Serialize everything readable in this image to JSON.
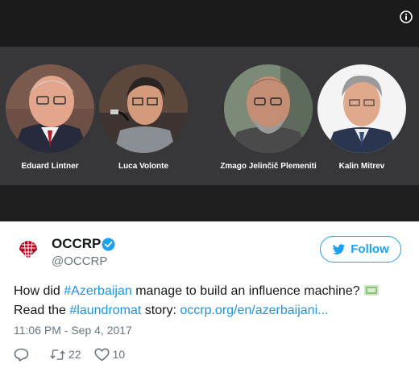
{
  "media": {
    "people": [
      {
        "name": "Eduard Lintner"
      },
      {
        "name": "Luca Volonte"
      },
      {
        "name": "Zmago Jelinčič Plemeniti"
      },
      {
        "name": "Kalin Mitrev"
      }
    ]
  },
  "account": {
    "name": "OCCRP",
    "handle": "@OCCRP",
    "verified": true,
    "logo_color": "#b8001c"
  },
  "follow_button": {
    "label": "Follow"
  },
  "tweet": {
    "line1_prefix": "How did ",
    "line1_hashtag": "#Azerbaijan",
    "line1_suffix": " manage to build an influence machine?",
    "line1_emoji": "money-icon",
    "line2_prefix": "Read the ",
    "line2_hashtag": "#laundromat",
    "line2_middle": " story: ",
    "line2_link": "occrp.org/en/azerbaijani...",
    "timestamp": "11:06 PM - Sep 4, 2017"
  },
  "actions": {
    "retweet_count": "22",
    "like_count": "10"
  },
  "colors": {
    "link": "#1b95e0",
    "twitter_blue": "#1da1f2",
    "secondary_text": "#66757f"
  }
}
